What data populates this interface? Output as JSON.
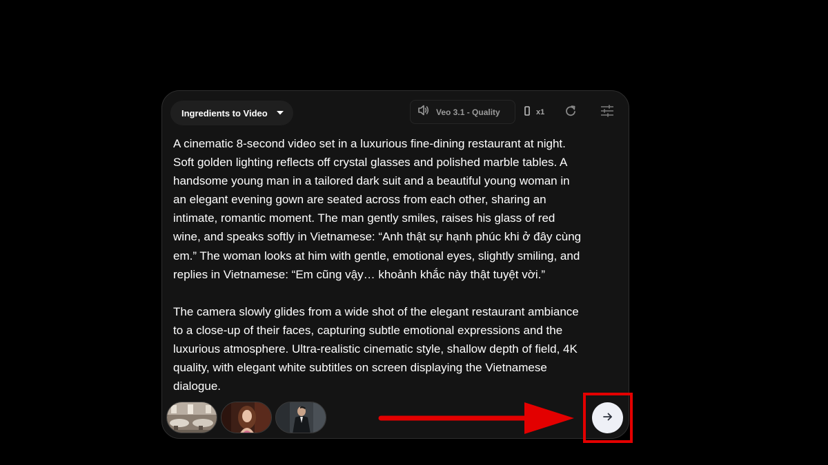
{
  "toolbar": {
    "mode_label": "Ingredients to Video",
    "model_label": "Veo 3.1 - Quality",
    "output_count": "x1"
  },
  "prompt": {
    "text": "A cinematic 8-second video set in a luxurious fine-dining restaurant at night.\nSoft golden lighting reflects off crystal glasses and polished marble tables. A\nhandsome young man in a tailored dark suit and a beautiful young woman in\nan elegant evening gown are seated across from each other, sharing an\nintimate, romantic moment. The man gently smiles, raises his glass of red\nwine, and speaks softly in Vietnamese: “Anh thật sự hạnh phúc khi ở đây cùng\nem.” The woman looks at him with gentle, emotional eyes, slightly smiling, and\nreplies in Vietnamese: “Em cũng vậy… khoảnh khắc này thật tuyệt vời.”\n\nThe camera slowly glides from a wide shot of the elegant restaurant ambiance\nto a close-up of their faces, capturing subtle emotional expressions and the\nluxurious atmosphere. Ultra-realistic cinematic style, shallow depth of field, 4K\nquality, with elegant white subtitles on screen displaying the Vietnamese\ndialogue."
  },
  "ingredients": [
    {
      "icon": "restaurant-interior-thumbnail"
    },
    {
      "icon": "woman-portrait-thumbnail"
    },
    {
      "icon": "man-in-suit-thumbnail"
    }
  ],
  "colors": {
    "background": "#000000",
    "panel": "#141414",
    "annotation": "#e30000",
    "submit_button": "#eef0f6"
  },
  "icons": {
    "caret": "caret-down-icon",
    "model": "speaker-icon",
    "ratio": "portrait-ratio-icon",
    "refresh": "refresh-icon",
    "settings": "sliders-icon",
    "submit": "arrow-right-icon"
  }
}
